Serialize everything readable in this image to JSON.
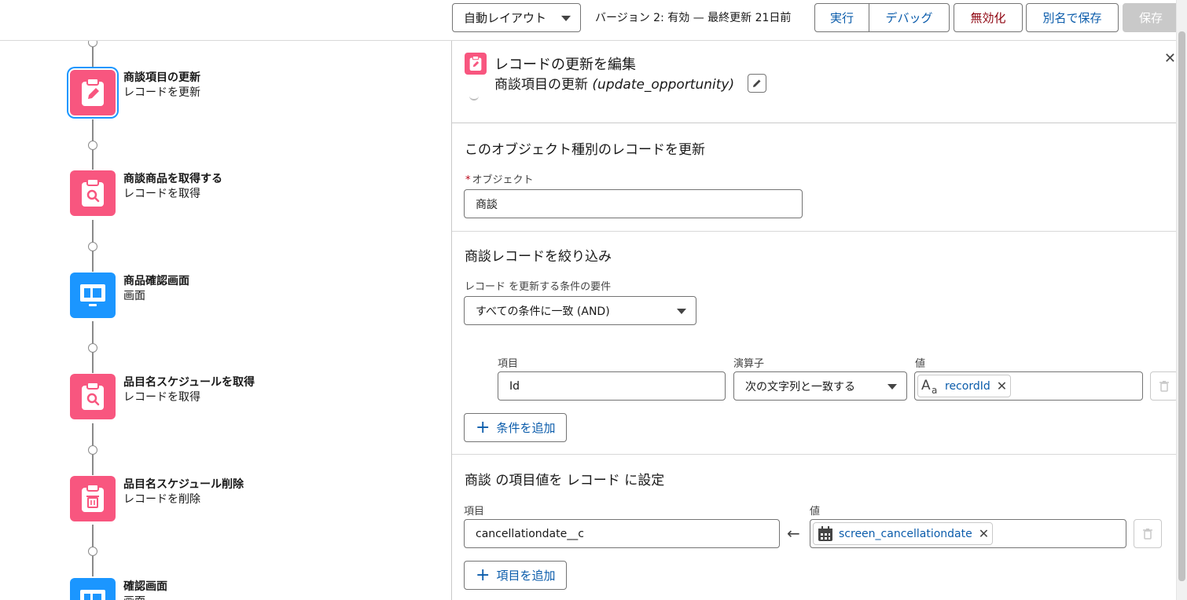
{
  "toolbar": {
    "layout_select": "自動レイアウト",
    "version_status": "バージョン 2: 有効 — 最終更新 21日前",
    "run_label": "実行",
    "debug_label": "デバッグ",
    "deactivate_label": "無効化",
    "save_as_label": "別名で保存",
    "save_label": "保存"
  },
  "flow": {
    "nodes": [
      {
        "title": "商談項目の更新",
        "subtitle": "レコードを更新",
        "icon": "update-record-icon",
        "color": "#f8567f",
        "selected": true
      },
      {
        "title": "商談商品を取得する",
        "subtitle": "レコードを取得",
        "icon": "get-records-icon",
        "color": "#f8567f"
      },
      {
        "title": "商品確認画面",
        "subtitle": "画面",
        "icon": "screen-icon",
        "color": "#1b96ff"
      },
      {
        "title": "品目名スケジュールを取得",
        "subtitle": "レコードを取得",
        "icon": "get-records-icon",
        "color": "#f8567f"
      },
      {
        "title": "品目名スケジュール削除",
        "subtitle": "レコードを削除",
        "icon": "delete-record-icon",
        "color": "#f8567f"
      },
      {
        "title": "確認画面",
        "subtitle": "画面",
        "icon": "screen-icon",
        "color": "#1b96ff"
      }
    ]
  },
  "panel": {
    "title": "レコードの更新を編集",
    "subtitle_label": "商談項目の更新",
    "subtitle_api": "(update_opportunity)",
    "section_object": {
      "title": "このオブジェクト種別のレコードを更新",
      "required_mark": "*",
      "object_label": "オブジェクト",
      "object_value": "商談"
    },
    "section_filter": {
      "title": "商談レコードを絞り込み",
      "condition_label": "レコード を更新する条件の要件",
      "condition_value": "すべての条件に一致 (AND)",
      "field_header": "項目",
      "operator_header": "演算子",
      "value_header": "値",
      "condition": {
        "field": "Id",
        "operator": "次の文字列と一致する",
        "value": "recordId"
      },
      "add_condition_label": "条件を追加"
    },
    "section_set": {
      "title": "商談 の項目値を レコード に設定",
      "field_header": "項目",
      "value_header": "値",
      "assignment": {
        "field": "cancellationdate__c",
        "value": "screen_cancellationdate"
      },
      "add_field_label": "項目を追加"
    }
  }
}
